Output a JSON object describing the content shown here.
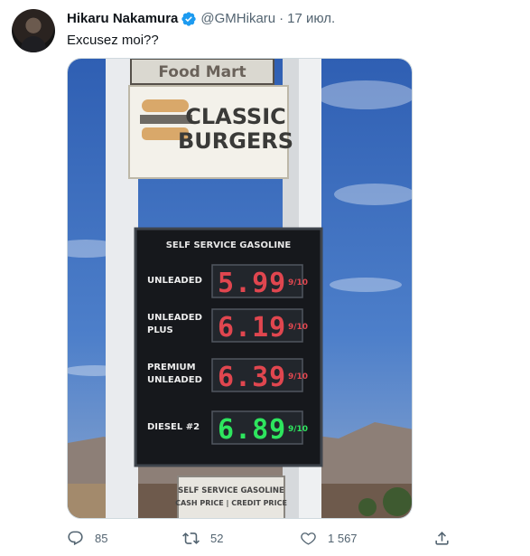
{
  "tweet": {
    "author_name": "Hikaru Nakamura",
    "handle": "@GMHikaru",
    "separator": "·",
    "date": "17 июл.",
    "text": "Excusez moi??"
  },
  "sign": {
    "store": "Food Mart",
    "restaurant_line1": "CLASSIC",
    "restaurant_line2": "BURGERS",
    "board_title": "SELF SERVICE GASOLINE",
    "grades": [
      {
        "label_line1": "UNLEADED",
        "label_line2": "",
        "price": "5.99",
        "fraction": "9/10"
      },
      {
        "label_line1": "UNLEADED",
        "label_line2": "PLUS",
        "price": "6.19",
        "fraction": "9/10"
      },
      {
        "label_line1": "PREMIUM",
        "label_line2": "UNLEADED",
        "price": "6.39",
        "fraction": "9/10"
      },
      {
        "label_line1": "DIESEL #2",
        "label_line2": "",
        "price": "6.89",
        "fraction": "9/10"
      }
    ],
    "bottom_sign_line1": "SELF SERVICE GASOLINE",
    "bottom_sign_line2": "CASH PRICE | CREDIT PRICE"
  },
  "actions": {
    "replies": "85",
    "retweets": "52",
    "likes": "1 567"
  },
  "colors": {
    "verified": "#1d9bf0",
    "meta_text": "#536471",
    "led_red": "#e0464f",
    "led_green": "#2ee55e",
    "sky": "#3f6fbf"
  }
}
